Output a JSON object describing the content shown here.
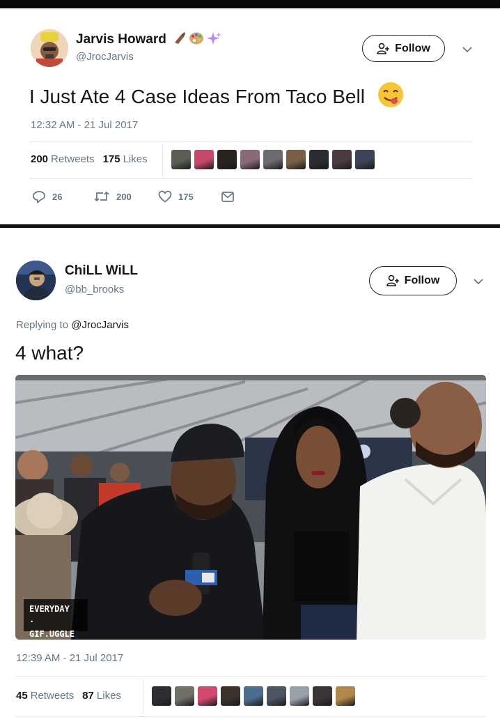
{
  "tweet1": {
    "name": "Jarvis Howard",
    "name_emojis": [
      "writing-hand-emoji",
      "artist-palette-emoji",
      "sparkles-emoji"
    ],
    "handle": "@JrocJarvis",
    "follow_label": "Follow",
    "text": "I Just Ate 4 Case Ideas From Taco  Bell",
    "text_emoji": "yum-face-emoji",
    "timestamp": "12:32 AM - 21 Jul 2017",
    "retweets_count": "200",
    "retweets_label": "Retweets",
    "likes_count": "175",
    "likes_label": "Likes",
    "likers": [
      "#5a5f55",
      "#c84a6b",
      "#2a2420",
      "#8a6a78",
      "#6d6a72",
      "#7a6047",
      "#2c2d33",
      "#4b3a40",
      "#3e4458"
    ],
    "actions": {
      "reply_count": "26",
      "retweet_count": "200",
      "like_count": "175"
    }
  },
  "tweet2": {
    "name": "ChiLL WiLL",
    "handle": "@bb_brooks",
    "follow_label": "Follow",
    "replying_prefix": "Replying to",
    "replying_handle": "@JrocJarvis",
    "text": "4 what?",
    "gif_badge": "EVERYDAY\n·\nGIF.UGGLE",
    "timestamp": "12:39 AM - 21 Jul 2017",
    "retweets_count": "45",
    "retweets_label": "Retweets",
    "likes_count": "87",
    "likes_label": "Likes",
    "likers": [
      "#2d2f33",
      "#6e7168",
      "#d24a70",
      "#3a332c",
      "#4c6e8e",
      "#4d5563",
      "#9aa0a8",
      "#3b3636",
      "#b0884a"
    ]
  },
  "colors": {
    "text_primary": "#14171a",
    "text_secondary": "#657786",
    "divider": "#e1e8ed"
  }
}
